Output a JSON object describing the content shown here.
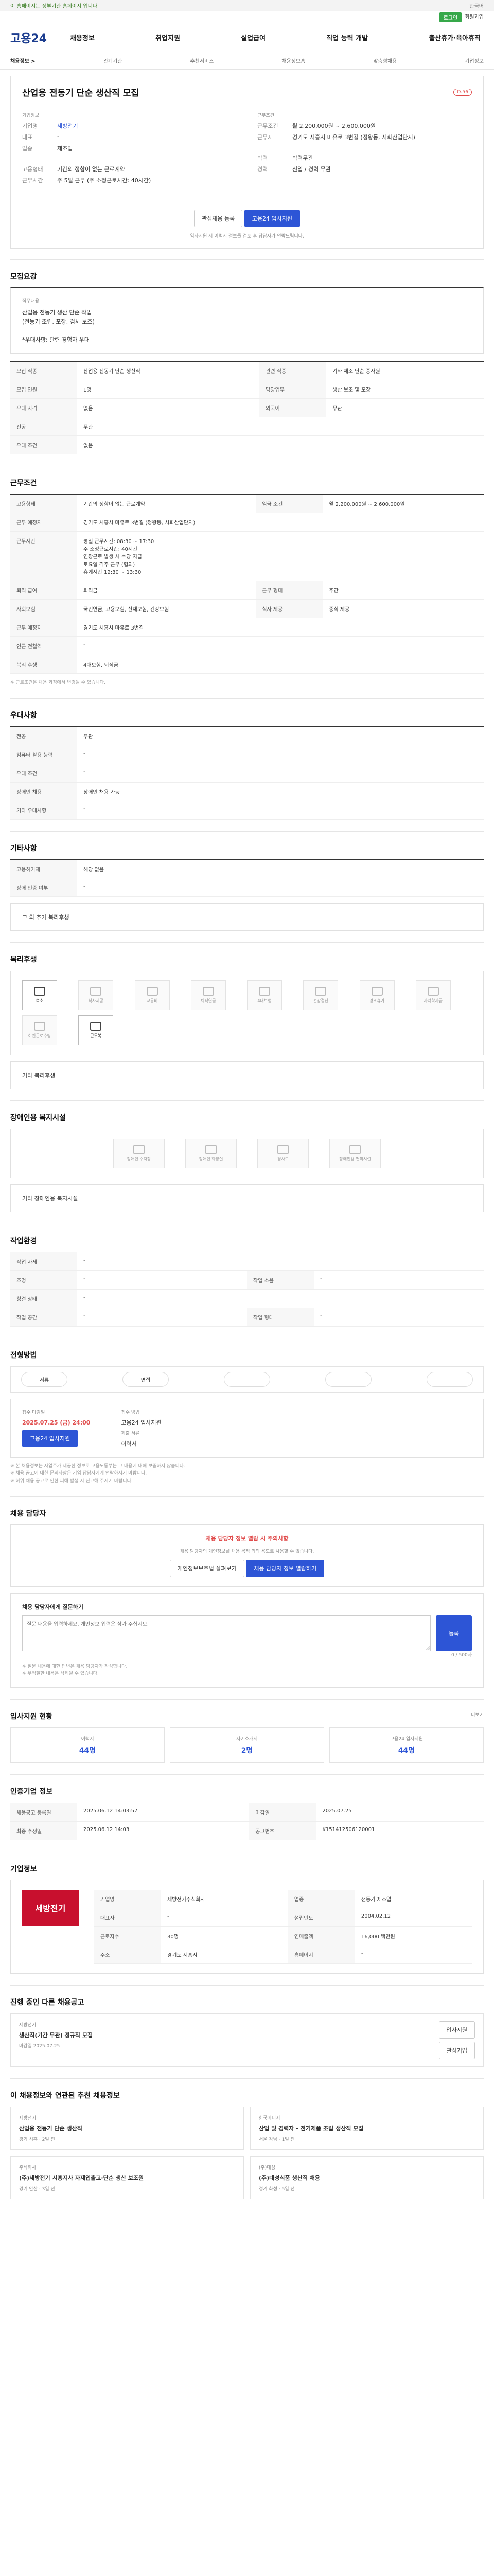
{
  "top": {
    "left": "이 홈페이지는 정부기관 홈페이지 입니다",
    "right": "한국어"
  },
  "sub": {
    "login": "로그인",
    "join": "회원가입"
  },
  "logo": "고용24",
  "gnb": [
    "채용정보",
    "취업지원",
    "실업급여",
    "직업 능력 개발",
    "출산휴가·육아휴직"
  ],
  "lnb": [
    "채용정보 >",
    "관계기관",
    "추천서비스",
    "채용정보홈",
    "맞춤형채용",
    "기업정보"
  ],
  "job": {
    "title": "산업용 전동기 단순 생산직 모집",
    "badge": "D-56",
    "company_label": "기업명",
    "company": "세방전기",
    "rep_label": "대표",
    "rep": "-",
    "type_label": "업종",
    "type": "제조업",
    "wage_label": "근무조건",
    "wage": "월 2,200,000원 ~ 2,600,000원",
    "addr_label": "근무지",
    "addr": "경기도 시흥시 마유로 3번길 (정왕동, 시화산업단지)",
    "emp_label": "고용형태",
    "emp": "기간의 정함이 없는 근로계약",
    "hours_label": "근무시간",
    "hours": "주 5일 근무 (주 소정근로시간: 40시간)",
    "edu_label": "학력",
    "edu": "학력무관",
    "career_label": "경력",
    "career": "신입 / 경력 무관",
    "scrap": "관심채용 등록",
    "apply": "고용24 입사지원",
    "note": "입사지원 시 이력서 정보를 검토 후 담당자가 연락드립니다."
  },
  "summary": {
    "title": "모집요강",
    "intro_label": "직무내용",
    "intro": "산업용 전동기 생산 단순 작업\n(전동기 조립, 포장, 검사 보조)\n\n*우대사항: 관련 경험자 우대",
    "rows": [
      [
        "모집 직종",
        "산업용 전동기 단순 생산직",
        "관련 직종",
        "기타 제조 단순 종사원"
      ],
      [
        "모집 인원",
        "1명",
        "담당업무",
        "생산 보조 및 포장"
      ],
      [
        "우대 자격",
        "없음",
        "외국어",
        "무관"
      ],
      [
        "전공",
        "무관",
        "",
        ""
      ],
      [
        "우대 조건",
        "없음",
        "",
        ""
      ]
    ]
  },
  "cond": {
    "title": "근무조건",
    "rows": [
      [
        "고용형태",
        "기간의 정함이 없는 근로계약",
        "임금 조건",
        "월 2,200,000원 ~ 2,600,000원"
      ],
      [
        "근무 예정지",
        "경기도 시흥시 마유로 3번길 (정왕동, 시화산업단지)",
        "",
        ""
      ],
      [
        "근무시간",
        "평일 근무시간: 08:30 ~ 17:30\n주 소정근로시간: 40시간\n연장근로 발생 시 수당 지급\n토요일 격주 근무 (협의)\n휴게시간 12:30 ~ 13:30",
        "",
        ""
      ],
      [
        "퇴직 급여",
        "퇴직금",
        "근무 형태",
        "주간"
      ],
      [
        "사회보험",
        "국민연금, 고용보험, 산재보험, 건강보험",
        "식사 제공",
        "중식 제공"
      ],
      [
        "근무 예정지",
        "경기도 시흥시 마유로 3번길",
        "",
        ""
      ],
      [
        "인근 전철역",
        "-",
        "",
        ""
      ],
      [
        "복리 후생",
        "4대보험, 퇴직금",
        "",
        ""
      ]
    ]
  },
  "docs": {
    "title": "우대사항",
    "rows": [
      [
        "전공",
        "무관"
      ],
      [
        "컴퓨터 활용 능력",
        "-"
      ],
      [
        "우대 조건",
        "-"
      ],
      [
        "장애인 채용",
        "장애인 채용 가능"
      ],
      [
        "기타 우대사항",
        "-"
      ]
    ]
  },
  "etc": {
    "title": "기타사항",
    "rows": [
      [
        "고용허가제",
        "해당 없음"
      ],
      [
        "장애 인증 여부",
        "-"
      ]
    ],
    "note": "그 외 추가 복리후생"
  },
  "welfare": {
    "title": "복리후생",
    "items": [
      "숙소",
      "식사제공",
      "교통비",
      "퇴직연금",
      "4대보험",
      "건강검진",
      "경조휴가",
      "자녀학자금",
      "야간근로수당",
      "근무복"
    ],
    "on": [
      1,
      10
    ],
    "note": "기타 복리후생"
  },
  "disab": {
    "title": "장애인용 복지시설",
    "items": [
      "장애인 주차장",
      "장애인 화장실",
      "경사로",
      "장애인용 편의시설"
    ],
    "note": "기타 장애인용 복지시설"
  },
  "work": {
    "title": "작업환경",
    "rows": [
      [
        "작업 자세",
        "-",
        "",
        ""
      ],
      [
        "조명",
        "-",
        "작업 소음",
        "-"
      ],
      [
        "청결 상태",
        "-",
        "",
        ""
      ],
      [
        "작업 공간",
        "-",
        "작업 형태",
        "-"
      ]
    ]
  },
  "proc": {
    "title": "전형방법",
    "steps": [
      "서류",
      "면접",
      "",
      "",
      ""
    ],
    "deadline_label": "접수 마감일",
    "deadline": "2025.07.25 (금) 24:00",
    "method_label": "접수 방법",
    "method": "고용24 입사지원",
    "docs_label": "제출 서류",
    "docs": "이력서",
    "apply": "고용24 입사지원"
  },
  "notes": [
    "※ 본 채용정보는 사업주가 제공한 정보로 고용노동부는 그 내용에 대해 보증하지 않습니다.",
    "※ 채용 공고에 대한 문의사항은 기업 담당자에게 연락하시기 바랍니다.",
    "※ 허위 채용 공고로 인한 피해 발생 시 신고해 주시기 바랍니다."
  ],
  "contact": {
    "title": "채용 담당자",
    "alert": "채용 담당자 정보 열람 시 주의사항",
    "desc": "채용 담당자의 개인정보를 채용 목적 외의 용도로 사용할 수 없습니다.",
    "b1": "개인정보보호법 살펴보기",
    "b2": "채용 담당자 정보 열람하기"
  },
  "qna": {
    "title": "채용 담당자에게 질문하기",
    "placeholder": "질문 내용을 입력하세요. 개인정보 입력은 삼가 주십시오.",
    "counter": "0 / 500자",
    "btn": "등록",
    "n1": "※ 질문 내용에 대한 답변은 채용 담당자가 작성합니다.",
    "n2": "※ 부적절한 내용은 삭제될 수 있습니다."
  },
  "stat": {
    "title": "입사지원 현황",
    "more": "더보기",
    "c": [
      [
        "이력서",
        "44명"
      ],
      [
        "자기소개서",
        "2명"
      ],
      [
        "고용24 입사지원",
        "44명"
      ]
    ]
  },
  "info": {
    "title": "인증기업 정보",
    "rows": [
      [
        "채용공고 등록일",
        "2025.06.12 14:03:57",
        "마감일",
        "2025.07.25"
      ],
      [
        "최종 수정일",
        "2025.06.12 14:03",
        "공고번호",
        "K151412506120001"
      ]
    ]
  },
  "corp": {
    "title": "기업정보",
    "name": "세방전기",
    "rows": [
      [
        "기업명",
        "세방전기주식회사",
        "업종",
        "전동기 제조업"
      ],
      [
        "대표자",
        "-",
        "설립년도",
        "2004.02.12"
      ],
      [
        "근로자수",
        "30명",
        "연매출액",
        "16,000 백만원"
      ],
      [
        "주소",
        "경기도 시흥시",
        "홈페이지",
        "-"
      ]
    ]
  },
  "other": {
    "title": "진행 중인 다른 채용공고",
    "job": "생산직(기간 무관) 정규직 모집",
    "tag": "세방전기",
    "deadline": "마감일 2025.07.25",
    "b1": "입사지원",
    "b2": "관심기업"
  },
  "recommend": {
    "title": "이 채용정보와 연관된 추천 채용정보",
    "cards": [
      [
        "세방전기",
        "산업용 전동기 단순 생산직",
        "경기 시흥",
        "2일 전"
      ],
      [
        "한국에너지",
        "산업 및 경력자 - 전기제품 조립 생산직 모집",
        "서울 강남",
        "1일 전"
      ],
      [
        "주식회사",
        "(주)세방전기 시흥지사 자재입출고·단순 생산 보조원",
        "경기 안산",
        "3일 전"
      ],
      [
        "(주)대성",
        "(주)대성식품 생산직 채용",
        "경기 화성",
        "5일 전"
      ]
    ]
  }
}
